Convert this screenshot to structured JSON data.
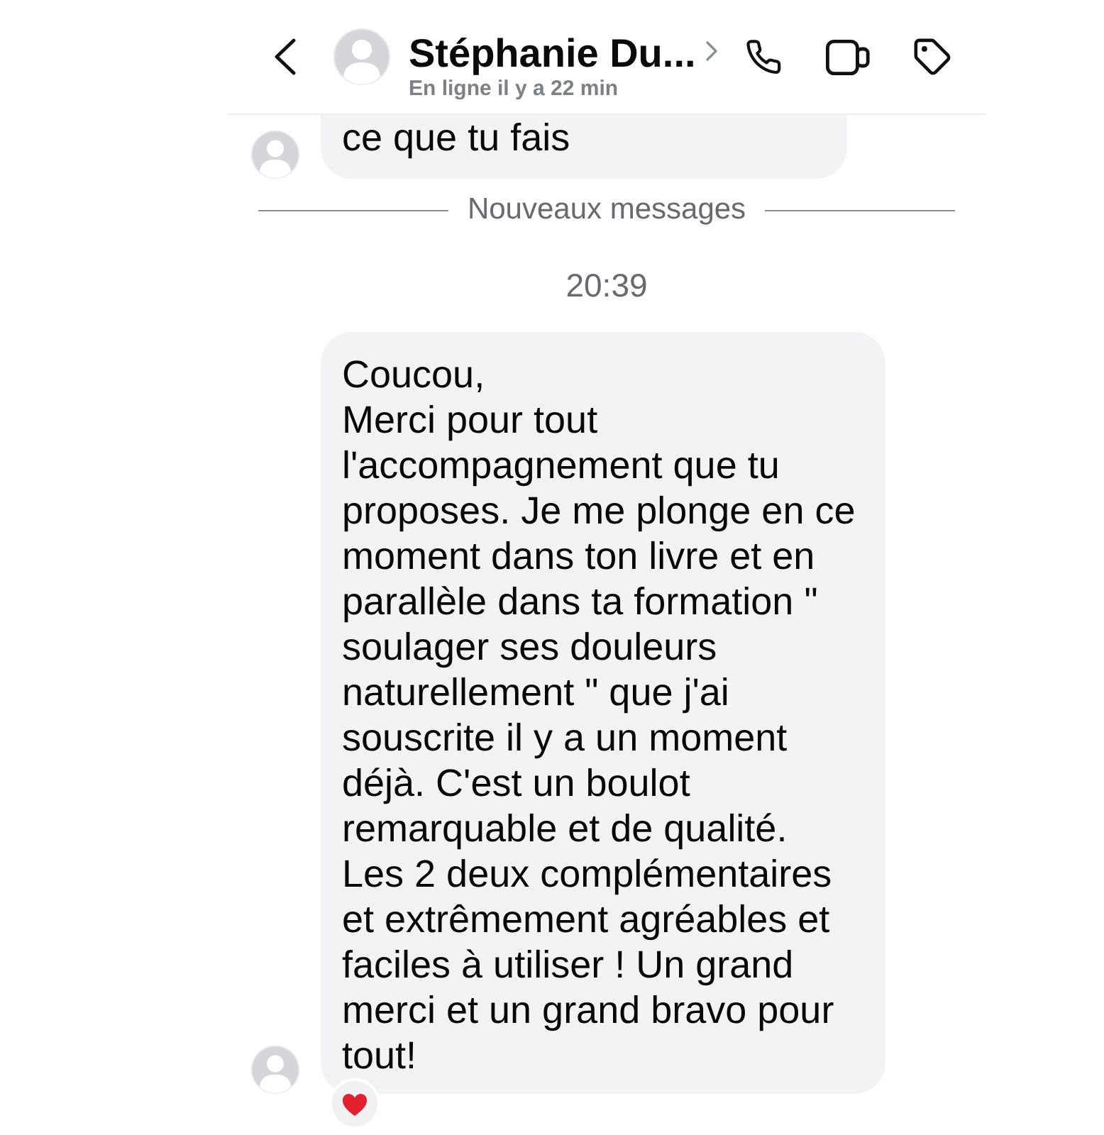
{
  "header": {
    "title": "Stéphanie Du...",
    "status": "En ligne il y a 22 min"
  },
  "conversation": [
    {
      "kind": "message",
      "text": "ce que tu fais",
      "cut_at_top": true,
      "reacted": false
    },
    {
      "kind": "divider",
      "text": "Nouveaux messages"
    },
    {
      "kind": "timestamp",
      "text": "20:39"
    },
    {
      "kind": "message",
      "text": "Coucou,\nMerci pour tout l'accompagnement que tu proposes. Je me plonge en ce moment dans ton livre et en parallèle dans ta formation \" soulager ses douleurs naturellement \" que j'ai souscrite il y a un moment déjà. C'est un boulot remarquable et de qualité. Les 2 deux complémentaires et extrêmement agréables et faciles à utiliser ! Un grand merci et un grand bravo pour tout!",
      "cut_at_top": false,
      "reacted": true
    }
  ]
}
